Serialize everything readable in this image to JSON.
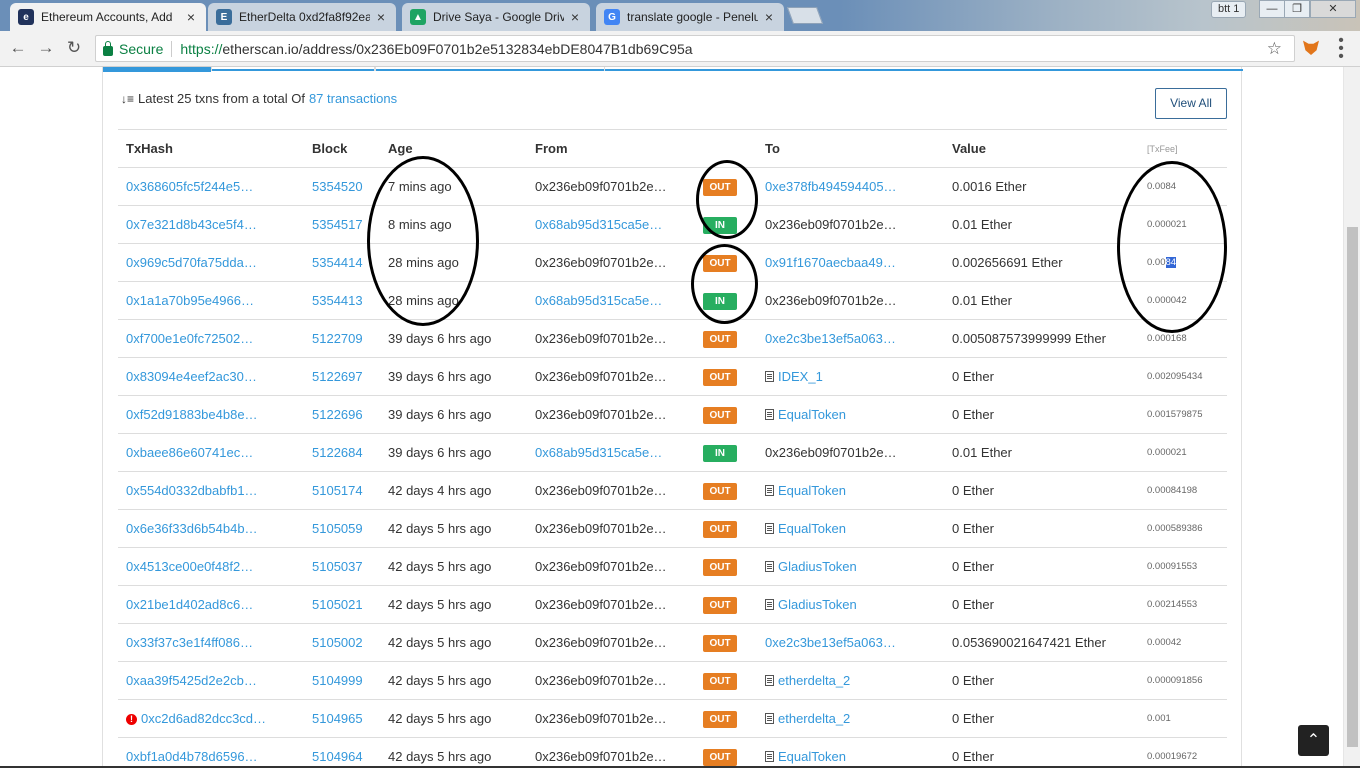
{
  "browser": {
    "tabs": [
      {
        "title": "Ethereum Accounts, Add",
        "active": true,
        "icon": "etherscan-icon"
      },
      {
        "title": "EtherDelta 0xd2fa8f92ea",
        "active": false,
        "icon": "etherdelta-icon"
      },
      {
        "title": "Drive Saya - Google Drive",
        "active": false,
        "icon": "google-drive-icon"
      },
      {
        "title": "translate google - Penelu",
        "active": false,
        "icon": "google-icon"
      }
    ],
    "window_label": "btt 1",
    "secure_label": "Secure",
    "url_scheme": "https://",
    "url_rest": "etherscan.io/address/0x236Eb09F0701b2e5132834ebDE8047B1db69C95a"
  },
  "summary": {
    "prefix": "Latest 25 txns from a total Of",
    "link": "87 transactions",
    "view_all": "View All"
  },
  "table": {
    "headers": {
      "txhash": "TxHash",
      "block": "Block",
      "age": "Age",
      "from": "From",
      "to": "To",
      "value": "Value",
      "fee": "[TxFee]"
    },
    "rows": [
      {
        "hash": "0x368605fc5f244e5…",
        "block": "5354520",
        "age": "7 mins ago",
        "from": "0x236eb09f0701b2e…",
        "from_link": false,
        "dir": "OUT",
        "to": "0xe378fb494594405…",
        "to_link": true,
        "to_contract": false,
        "value": "0.0016 Ether",
        "fee": "0.0084",
        "error": false
      },
      {
        "hash": "0x7e321d8b43ce5f4…",
        "block": "5354517",
        "age": "8 mins ago",
        "from": "0x68ab95d315ca5e…",
        "from_link": true,
        "dir": "IN",
        "to": "0x236eb09f0701b2e…",
        "to_link": false,
        "to_contract": false,
        "value": "0.01 Ether",
        "fee": "0.000021",
        "error": false
      },
      {
        "hash": "0x969c5d70fa75dda…",
        "block": "5354414",
        "age": "28 mins ago",
        "from": "0x236eb09f0701b2e…",
        "from_link": false,
        "dir": "OUT",
        "to": "0x91f1670aecbaa49…",
        "to_link": true,
        "to_contract": false,
        "value": "0.002656691 Ether",
        "fee": "0.0084",
        "error": false
      },
      {
        "hash": "0x1a1a70b95e4966…",
        "block": "5354413",
        "age": "28 mins ago",
        "from": "0x68ab95d315ca5e…",
        "from_link": true,
        "dir": "IN",
        "to": "0x236eb09f0701b2e…",
        "to_link": false,
        "to_contract": false,
        "value": "0.01 Ether",
        "fee": "0.000042",
        "error": false
      },
      {
        "hash": "0xf700e1e0fc72502…",
        "block": "5122709",
        "age": "39 days 6 hrs ago",
        "from": "0x236eb09f0701b2e…",
        "from_link": false,
        "dir": "OUT",
        "to": "0xe2c3be13ef5a063…",
        "to_link": true,
        "to_contract": false,
        "value": "0.005087573999999 Ether",
        "fee": "0.000168",
        "error": false
      },
      {
        "hash": "0x83094e4eef2ac30…",
        "block": "5122697",
        "age": "39 days 6 hrs ago",
        "from": "0x236eb09f0701b2e…",
        "from_link": false,
        "dir": "OUT",
        "to": "IDEX_1",
        "to_link": true,
        "to_contract": true,
        "value": "0 Ether",
        "fee": "0.002095434",
        "error": false
      },
      {
        "hash": "0xf52d91883be4b8e…",
        "block": "5122696",
        "age": "39 days 6 hrs ago",
        "from": "0x236eb09f0701b2e…",
        "from_link": false,
        "dir": "OUT",
        "to": "EqualToken",
        "to_link": true,
        "to_contract": true,
        "value": "0 Ether",
        "fee": "0.001579875",
        "error": false
      },
      {
        "hash": "0xbaee86e60741ec…",
        "block": "5122684",
        "age": "39 days 6 hrs ago",
        "from": "0x68ab95d315ca5e…",
        "from_link": true,
        "dir": "IN",
        "to": "0x236eb09f0701b2e…",
        "to_link": false,
        "to_contract": false,
        "value": "0.01 Ether",
        "fee": "0.000021",
        "error": false
      },
      {
        "hash": "0x554d0332dbabfb1…",
        "block": "5105174",
        "age": "42 days 4 hrs ago",
        "from": "0x236eb09f0701b2e…",
        "from_link": false,
        "dir": "OUT",
        "to": "EqualToken",
        "to_link": true,
        "to_contract": true,
        "value": "0 Ether",
        "fee": "0.00084198",
        "error": false
      },
      {
        "hash": "0x6e36f33d6b54b4b…",
        "block": "5105059",
        "age": "42 days 5 hrs ago",
        "from": "0x236eb09f0701b2e…",
        "from_link": false,
        "dir": "OUT",
        "to": "EqualToken",
        "to_link": true,
        "to_contract": true,
        "value": "0 Ether",
        "fee": "0.000589386",
        "error": false
      },
      {
        "hash": "0x4513ce00e0f48f2…",
        "block": "5105037",
        "age": "42 days 5 hrs ago",
        "from": "0x236eb09f0701b2e…",
        "from_link": false,
        "dir": "OUT",
        "to": "GladiusToken",
        "to_link": true,
        "to_contract": true,
        "value": "0 Ether",
        "fee": "0.00091553",
        "error": false
      },
      {
        "hash": "0x21be1d402ad8c6…",
        "block": "5105021",
        "age": "42 days 5 hrs ago",
        "from": "0x236eb09f0701b2e…",
        "from_link": false,
        "dir": "OUT",
        "to": "GladiusToken",
        "to_link": true,
        "to_contract": true,
        "value": "0 Ether",
        "fee": "0.00214553",
        "error": false
      },
      {
        "hash": "0x33f37c3e1f4ff086…",
        "block": "5105002",
        "age": "42 days 5 hrs ago",
        "from": "0x236eb09f0701b2e…",
        "from_link": false,
        "dir": "OUT",
        "to": "0xe2c3be13ef5a063…",
        "to_link": true,
        "to_contract": false,
        "value": "0.053690021647421 Ether",
        "fee": "0.00042",
        "error": false
      },
      {
        "hash": "0xaa39f5425d2e2cb…",
        "block": "5104999",
        "age": "42 days 5 hrs ago",
        "from": "0x236eb09f0701b2e…",
        "from_link": false,
        "dir": "OUT",
        "to": "etherdelta_2",
        "to_link": true,
        "to_contract": true,
        "value": "0 Ether",
        "fee": "0.000091856",
        "error": false
      },
      {
        "hash": "0xc2d6ad82dcc3cd…",
        "block": "5104965",
        "age": "42 days 5 hrs ago",
        "from": "0x236eb09f0701b2e…",
        "from_link": false,
        "dir": "OUT",
        "to": "etherdelta_2",
        "to_link": true,
        "to_contract": true,
        "value": "0 Ether",
        "fee": "0.001",
        "error": true
      },
      {
        "hash": "0xbf1a0d4b78d6596…",
        "block": "5104964",
        "age": "42 days 5 hrs ago",
        "from": "0x236eb09f0701b2e…",
        "from_link": false,
        "dir": "OUT",
        "to": "EqualToken",
        "to_link": true,
        "to_contract": true,
        "value": "0 Ether",
        "fee": "0.00019672",
        "error": false
      }
    ]
  },
  "colors": {
    "link": "#3498db",
    "out_badge": "#e67e22",
    "in_badge": "#27ae60",
    "secure": "#0b8043"
  }
}
